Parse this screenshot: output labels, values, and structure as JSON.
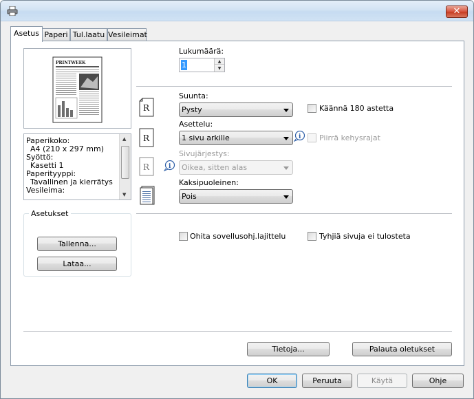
{
  "titlebar": {
    "title": "",
    "close_label": "✕"
  },
  "tabs": [
    {
      "label": "Asetus",
      "active": true
    },
    {
      "label": "Paperi",
      "active": false
    },
    {
      "label": "Tul.laatu",
      "active": false
    },
    {
      "label": "Vesileimat",
      "active": false
    }
  ],
  "preview": {
    "masthead": "PRINTWEEK"
  },
  "info_list": [
    "Paperikoko:",
    "A4 (210 x 297 mm)",
    "Syöttö:",
    "Kasetti 1",
    "Paperityyppi:",
    "Tavallinen ja kierrätys",
    "Vesileima:"
  ],
  "settings_group": {
    "title": "Asetukset",
    "save_label": "Tallenna...",
    "load_label": "Lataa..."
  },
  "copies": {
    "label": "Lukumäärä:",
    "value": "1"
  },
  "orientation": {
    "label": "Suunta:",
    "value": "Pysty",
    "icon_letter": "R"
  },
  "rotate180": {
    "label": "Käännä 180 astetta",
    "checked": false
  },
  "layout": {
    "label": "Asettelu:",
    "value": "1 sivu arkille",
    "icon_letter": "R"
  },
  "draw_borders": {
    "label": "Piirrä kehysrajat",
    "checked": false,
    "enabled": false
  },
  "page_order": {
    "label": "Sivujärjestys:",
    "value": "Oikea, sitten alas",
    "enabled": false,
    "icon_letter": "R"
  },
  "duplex": {
    "label": "Kaksipuoleinen:",
    "value": "Pois"
  },
  "skip_collation": {
    "label": "Ohita sovellusohj.lajittelu",
    "checked": false
  },
  "skip_blank": {
    "label": "Tyhjiä sivuja ei tulosteta",
    "checked": false
  },
  "bottom_buttons": {
    "about_label": "Tietoja...",
    "restore_label": "Palauta oletukset"
  },
  "dialog_buttons": {
    "ok_label": "OK",
    "cancel_label": "Peruuta",
    "apply_label": "Käytä",
    "help_label": "Ohje"
  },
  "colors": {
    "accent": "#3399ff",
    "info_icon": "#2e5fa8",
    "close": "#c73a20"
  }
}
